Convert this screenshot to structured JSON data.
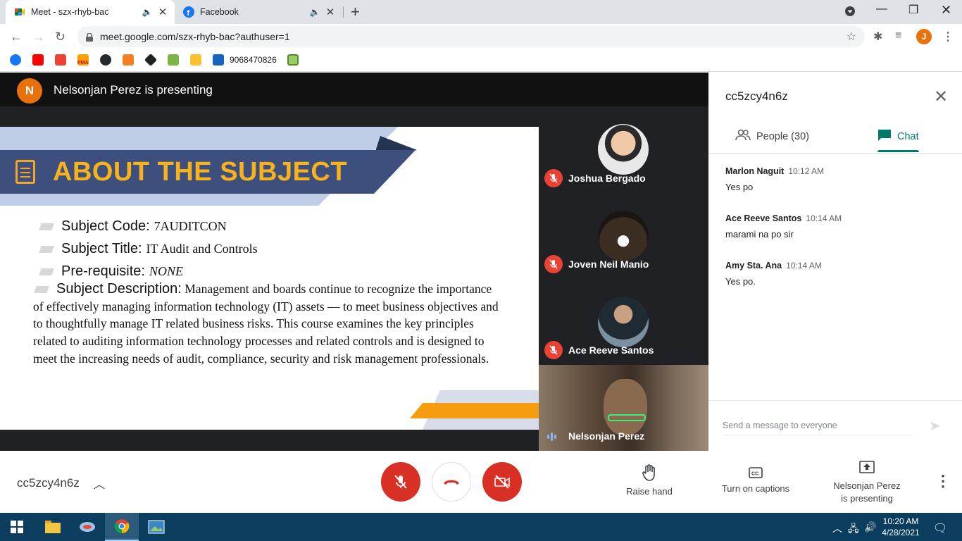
{
  "browser": {
    "tabs": [
      {
        "title": "Meet - szx-rhyb-bac",
        "active": true
      },
      {
        "title": "Facebook",
        "active": false
      }
    ],
    "url": "meet.google.com/szx-rhyb-bac?authuser=1",
    "profile_initial": "J",
    "bookmark_text": "9068470826",
    "bookmark_pma": "PMA"
  },
  "meet": {
    "presenter_initial": "N",
    "presenter_banner": "Nelsonjan Perez is presenting",
    "slide": {
      "title": "ABOUT THE SUBJECT",
      "items": [
        {
          "label": "Subject Code:",
          "value": "7AUDITCON"
        },
        {
          "label": "Subject Title:",
          "value": "IT Audit and Controls"
        },
        {
          "label": "Pre-requisite:",
          "value": "NONE"
        }
      ],
      "description_label": "Subject Description:",
      "description": "Management and boards continue to recognize the importance of effectively managing information technology (IT) assets — to meet business objectives and to thoughtfully manage IT related business risks. This course examines the key principles related to auditing information technology processes and related controls and is designed to meet the increasing needs of audit, compliance, security and risk management professionals."
    },
    "participants": [
      {
        "name": "Joshua Bergado",
        "muted": true
      },
      {
        "name": "Joven Neil Manio",
        "muted": true
      },
      {
        "name": "Ace Reeve Santos",
        "muted": true
      }
    ],
    "self_tile": {
      "name": "Nelsonjan Perez",
      "speaking": true
    },
    "panel": {
      "title": "cc5zcy4n6z",
      "tab_people": "People (30)",
      "tab_chat": "Chat",
      "messages": [
        {
          "sender": "Marlon Naguit",
          "time": "10:12 AM",
          "text": "Yes po"
        },
        {
          "sender": "Ace Reeve Santos",
          "time": "10:14 AM",
          "text": "marami na po sir"
        },
        {
          "sender": "Amy Sta. Ana",
          "time": "10:14 AM",
          "text": "Yes po."
        }
      ],
      "compose_placeholder": "Send a message to everyone"
    },
    "controls": {
      "meeting_code": "cc5zcy4n6z",
      "raise_hand": "Raise hand",
      "captions": "Turn on captions",
      "presenting_line1": "Nelsonjan Perez",
      "presenting_line2": "is presenting"
    },
    "colors": {
      "accent_green": "#00796b",
      "mute_red": "#d93025",
      "presenter_orange": "#e8710a",
      "slide_title": "#f8b31c"
    }
  },
  "taskbar": {
    "time": "10:20 AM",
    "date": "4/28/2021"
  }
}
